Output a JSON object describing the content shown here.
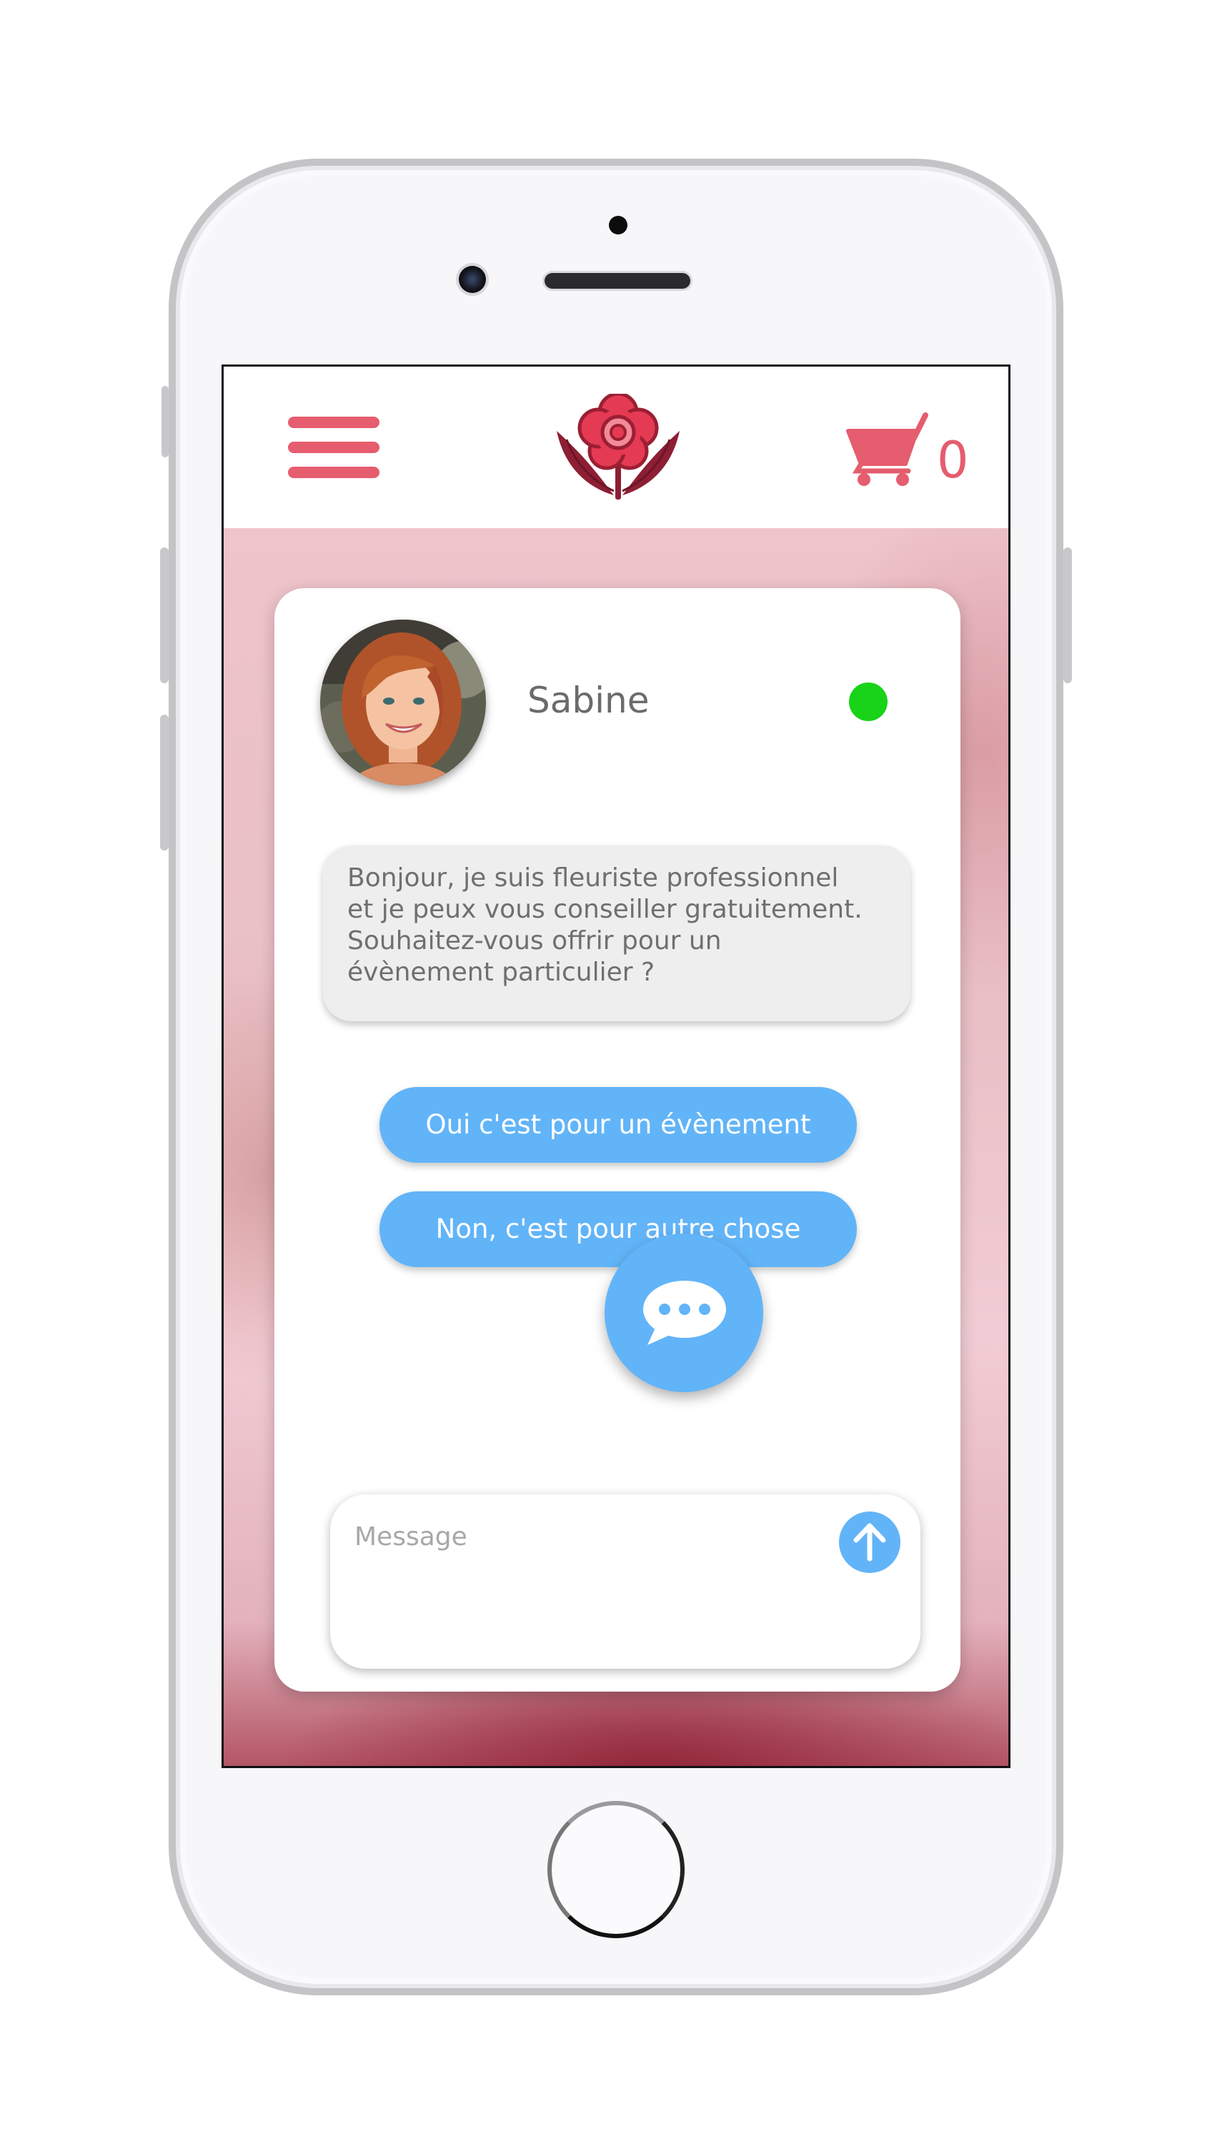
{
  "header": {
    "menu_icon": "hamburger-menu-icon",
    "logo_icon": "flower-logo-icon",
    "cart_icon": "shopping-cart-icon",
    "cart_count": "0"
  },
  "chat": {
    "agent_name": "Sabine",
    "agent_status_color": "#18d318",
    "message_lines": [
      "Bonjour, je suis fleuriste professionnel",
      "et je peux vous conseiller gratuitement.",
      "Souhaitez-vous offrir pour un",
      "évènement particulier ?"
    ],
    "choices": [
      "Oui c'est pour un évènement",
      "Non, c'est pour autre chose"
    ],
    "input_placeholder": "Message",
    "send_icon": "arrow-up-icon",
    "fab_icon": "chat-bubble-icon"
  },
  "colors": {
    "accent_pink": "#e55d6e",
    "button_blue": "#62b4f8",
    "online_green": "#18d318"
  }
}
